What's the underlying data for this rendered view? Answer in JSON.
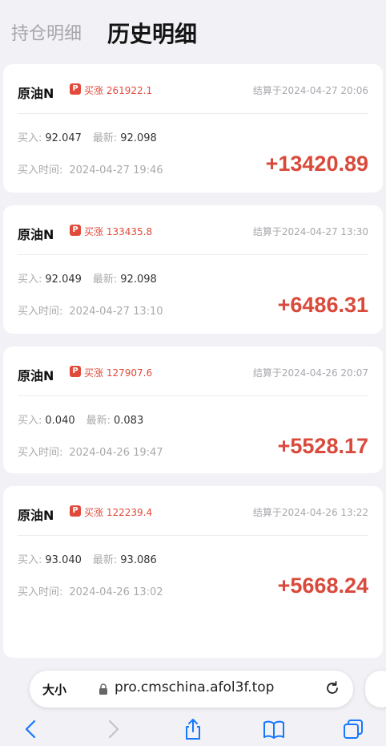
{
  "tabs": {
    "positions": "持仓明细",
    "history": "历史明细"
  },
  "cards": [
    {
      "name": "原油N",
      "tag_icon": "P",
      "tag": "买涨 261922.1",
      "settle": "结算于2024-04-27 20:06",
      "buy_label": "买入:",
      "buy": "92.047",
      "latest_label": "最新:",
      "latest": "92.098",
      "time_label": "买入时间:",
      "time": "2024-04-27 19:46",
      "profit": "+13420.89"
    },
    {
      "name": "原油N",
      "tag_icon": "P",
      "tag": "买涨 133435.8",
      "settle": "结算于2024-04-27 13:30",
      "buy_label": "买入:",
      "buy": "92.049",
      "latest_label": "最新:",
      "latest": "92.098",
      "time_label": "买入时间:",
      "time": "2024-04-27 13:10",
      "profit": "+6486.31"
    },
    {
      "name": "原油N",
      "tag_icon": "P",
      "tag": "买涨 127907.6",
      "settle": "结算于2024-04-26 20:07",
      "buy_label": "买入:",
      "buy": "0.040",
      "latest_label": "最新:",
      "latest": "0.083",
      "time_label": "买入时间:",
      "time": "2024-04-26 19:47",
      "profit": "+5528.17"
    },
    {
      "name": "原油N",
      "tag_icon": "P",
      "tag": "买涨 122239.4",
      "settle": "结算于2024-04-26 13:22",
      "buy_label": "买入:",
      "buy": "93.040",
      "latest_label": "最新:",
      "latest": "93.086",
      "time_label": "买入时间:",
      "time": "2024-04-26 13:02",
      "profit": "+5668.24"
    }
  ],
  "browser": {
    "text_size": "大小",
    "url": "pro.cmschina.afol3f.top"
  },
  "colors": {
    "profit": "#d94a3c",
    "accent_ios": "#1677ff",
    "background": "#f2f2f6"
  },
  "icons": [
    "lock-icon",
    "reload-icon",
    "back-icon",
    "forward-icon",
    "share-icon",
    "bookmarks-icon",
    "tabs-icon"
  ]
}
